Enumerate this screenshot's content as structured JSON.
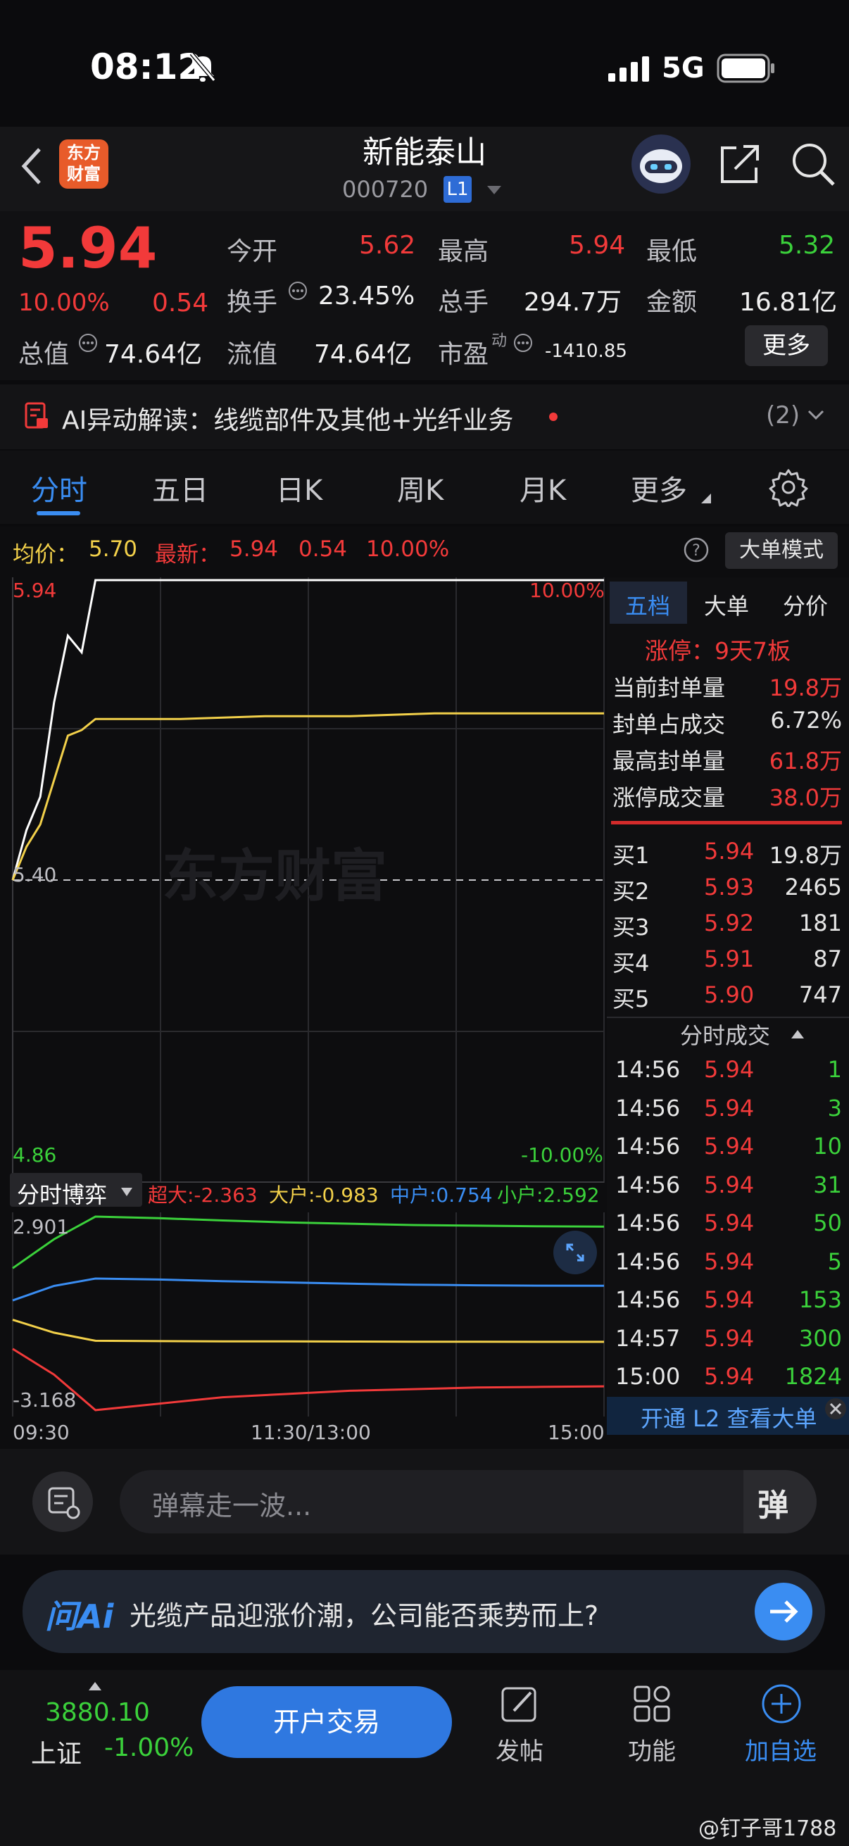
{
  "status_bar": {
    "time": "08:12",
    "network": "5G"
  },
  "header": {
    "name": "新能泰山",
    "code": "000720",
    "level": "L1",
    "logo_text_1": "东方",
    "logo_text_2": "财富"
  },
  "quote": {
    "price": "5.94",
    "change_pct": "10.00%",
    "change": "0.54",
    "open_label": "今开",
    "open": "5.62",
    "high_label": "最高",
    "high": "5.94",
    "low_label": "最低",
    "low": "5.32",
    "turnover_label": "换手",
    "turnover": "23.45%",
    "volume_label": "总手",
    "volume": "294.7万",
    "amount_label": "金额",
    "amount": "16.81亿",
    "mcap_label": "总值",
    "mcap": "74.64亿",
    "float_label": "流值",
    "float": "74.64亿",
    "pe_label": "市盈",
    "pe_sup": "动",
    "pe": "-1410.85",
    "more": "更多"
  },
  "ai_row": {
    "text": "AI异动解读：线缆部件及其他+光纤业务",
    "count": "(2)"
  },
  "tabs": [
    "分时",
    "五日",
    "日K",
    "周K",
    "月K",
    "更多"
  ],
  "info": {
    "avg_label": "均价：",
    "avg": "5.70",
    "latest_label": "最新：",
    "latest": "5.94",
    "latest_change": "0.54",
    "latest_pct": "10.00%",
    "mode": "大单模式"
  },
  "chart_data": [
    {
      "type": "line",
      "title": "",
      "y_top_label": "5.94",
      "y_mid_label": "5.40",
      "y_bottom_label": "4.86",
      "pct_top_label": "10.00%",
      "pct_bottom_label": "-10.00%",
      "watermark": "东方财富",
      "ylim": [
        4.86,
        5.94
      ],
      "x": [
        "09:30",
        "11:30/13:00",
        "15:00"
      ],
      "series": [
        {
          "name": "price",
          "color": "#ffffff",
          "values": [
            5.4,
            5.49,
            5.55,
            5.72,
            5.84,
            5.81,
            5.94,
            5.94,
            5.94,
            5.94,
            5.94,
            5.94,
            5.94
          ]
        },
        {
          "name": "avg",
          "color": "#f2d04a",
          "values": [
            5.4,
            5.46,
            5.5,
            5.58,
            5.66,
            5.67,
            5.69,
            5.69,
            5.695,
            5.695,
            5.7,
            5.7,
            5.7
          ]
        }
      ]
    },
    {
      "type": "line",
      "title": "分时博弈",
      "y_top_label": "2.901",
      "y_bottom_label": "-3.168",
      "ylim": [
        -3.168,
        2.901
      ],
      "x_labels": [
        "09:30",
        "11:30/13:00",
        "15:00"
      ],
      "series": [
        {
          "name": "超大",
          "color": "#f23a3a",
          "label": "超大:-2.363",
          "values": [
            -1.2,
            -2.0,
            -3.1,
            -2.9,
            -2.7,
            -2.6,
            -2.5,
            -2.45,
            -2.4,
            -2.38,
            -2.363
          ]
        },
        {
          "name": "大户",
          "color": "#f2d04a",
          "label": "大户:-0.983",
          "values": [
            -0.3,
            -0.7,
            -0.95,
            -0.96,
            -0.97,
            -0.97,
            -0.975,
            -0.98,
            -0.98,
            -0.982,
            -0.983
          ]
        },
        {
          "name": "中户",
          "color": "#3a8df2",
          "label": "中户:0.754",
          "values": [
            0.3,
            0.75,
            0.98,
            0.95,
            0.9,
            0.86,
            0.82,
            0.79,
            0.77,
            0.76,
            0.754
          ]
        },
        {
          "name": "小户",
          "color": "#3bd13b",
          "label": "小户:2.592",
          "values": [
            1.3,
            2.2,
            2.9,
            2.85,
            2.78,
            2.72,
            2.68,
            2.64,
            2.62,
            2.6,
            2.592
          ]
        }
      ]
    }
  ],
  "right_panel": {
    "tabs": [
      "五档",
      "大单",
      "分价"
    ],
    "limit_up": "涨停：9天7板",
    "stats": [
      {
        "label": "当前封单量",
        "value": "19.8万"
      },
      {
        "label": "封单占成交",
        "value": "6.72%"
      },
      {
        "label": "最高封单量",
        "value": "61.8万"
      },
      {
        "label": "涨停成交量",
        "value": "38.0万"
      }
    ],
    "bids": [
      {
        "label": "买1",
        "price": "5.94",
        "vol": "19.8万"
      },
      {
        "label": "买2",
        "price": "5.93",
        "vol": "2465"
      },
      {
        "label": "买3",
        "price": "5.92",
        "vol": "181"
      },
      {
        "label": "买4",
        "price": "5.91",
        "vol": "87"
      },
      {
        "label": "买5",
        "price": "5.90",
        "vol": "747"
      }
    ],
    "ticks_title": "分时成交",
    "ticks": [
      {
        "time": "14:56",
        "price": "5.94",
        "vol": "1"
      },
      {
        "time": "14:56",
        "price": "5.94",
        "vol": "3"
      },
      {
        "time": "14:56",
        "price": "5.94",
        "vol": "10"
      },
      {
        "time": "14:56",
        "price": "5.94",
        "vol": "31"
      },
      {
        "time": "14:56",
        "price": "5.94",
        "vol": "50"
      },
      {
        "time": "14:56",
        "price": "5.94",
        "vol": "5"
      },
      {
        "time": "14:56",
        "price": "5.94",
        "vol": "153"
      },
      {
        "time": "14:57",
        "price": "5.94",
        "vol": "300"
      },
      {
        "time": "15:00",
        "price": "5.94",
        "vol": "1824"
      }
    ],
    "l2_banner": "开通 L2 查看大单"
  },
  "comment": {
    "placeholder": "弹幕走一波...",
    "danmu": "弹"
  },
  "ask_ai": {
    "brand": "问Ai",
    "question": "光缆产品迎涨价潮，公司能否乘势而上?"
  },
  "bottom": {
    "index_value": "3880.10",
    "index_name": "上证",
    "index_pct": "-1.00%",
    "open_account": "开户交易",
    "post": "发帖",
    "function": "功能",
    "add": "加自选"
  },
  "watermark_footer": "@钉子哥1788"
}
